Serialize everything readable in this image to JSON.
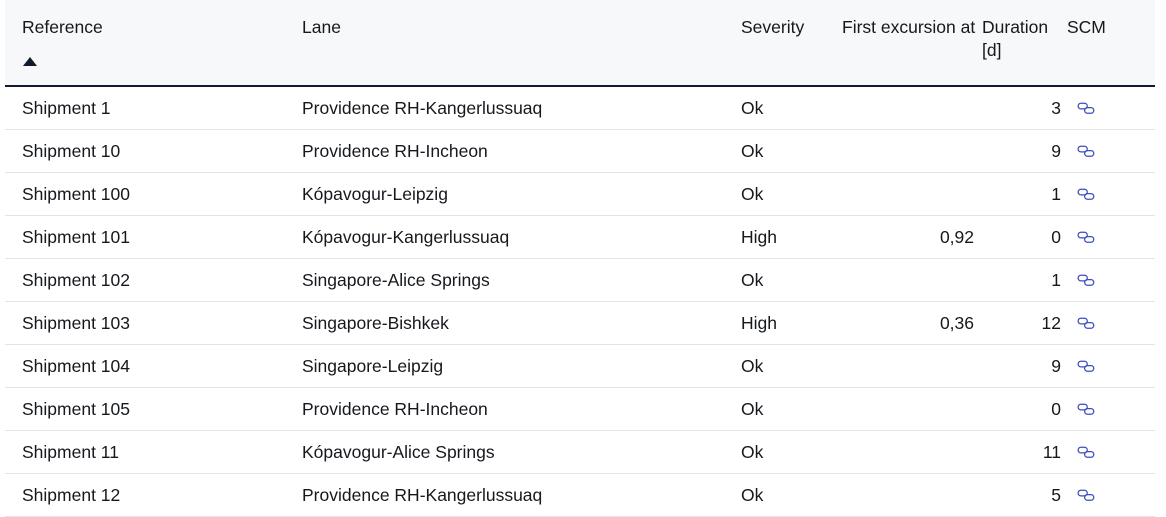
{
  "table": {
    "columns": [
      {
        "key": "reference",
        "label": "Reference",
        "align": "left",
        "sorted": "asc",
        "sort_icon": "sort-ascending-triangle-icon"
      },
      {
        "key": "lane",
        "label": "Lane",
        "align": "left"
      },
      {
        "key": "severity",
        "label": "Severity",
        "align": "left"
      },
      {
        "key": "first_excursion_at",
        "label": "First excursion at",
        "align": "right"
      },
      {
        "key": "duration",
        "label": "Duration [d]",
        "align": "right"
      },
      {
        "key": "scm",
        "label": "SCM",
        "align": "left"
      }
    ],
    "rows": [
      {
        "reference": "Shipment 1",
        "lane": "Providence RH-Kangerlussuaq",
        "severity": "Ok",
        "first_excursion_at": "",
        "duration": "3",
        "scm_icon": "chain-link-icon"
      },
      {
        "reference": "Shipment 10",
        "lane": "Providence RH-Incheon",
        "severity": "Ok",
        "first_excursion_at": "",
        "duration": "9",
        "scm_icon": "chain-link-icon"
      },
      {
        "reference": "Shipment 100",
        "lane": "Kópavogur-Leipzig",
        "severity": "Ok",
        "first_excursion_at": "",
        "duration": "1",
        "scm_icon": "chain-link-icon"
      },
      {
        "reference": "Shipment 101",
        "lane": "Kópavogur-Kangerlussuaq",
        "severity": "High",
        "first_excursion_at": "0,92",
        "duration": "0",
        "scm_icon": "chain-link-icon"
      },
      {
        "reference": "Shipment 102",
        "lane": "Singapore-Alice Springs",
        "severity": "Ok",
        "first_excursion_at": "",
        "duration": "1",
        "scm_icon": "chain-link-icon"
      },
      {
        "reference": "Shipment 103",
        "lane": "Singapore-Bishkek",
        "severity": "High",
        "first_excursion_at": "0,36",
        "duration": "12",
        "scm_icon": "chain-link-icon"
      },
      {
        "reference": "Shipment 104",
        "lane": "Singapore-Leipzig",
        "severity": "Ok",
        "first_excursion_at": "",
        "duration": "9",
        "scm_icon": "chain-link-icon"
      },
      {
        "reference": "Shipment 105",
        "lane": "Providence RH-Incheon",
        "severity": "Ok",
        "first_excursion_at": "",
        "duration": "0",
        "scm_icon": "chain-link-icon"
      },
      {
        "reference": "Shipment 11",
        "lane": "Kópavogur-Alice Springs",
        "severity": "Ok",
        "first_excursion_at": "",
        "duration": "11",
        "scm_icon": "chain-link-icon"
      },
      {
        "reference": "Shipment 12",
        "lane": "Providence RH-Kangerlussuaq",
        "severity": "Ok",
        "first_excursion_at": "",
        "duration": "5",
        "scm_icon": "chain-link-icon"
      }
    ]
  },
  "colors": {
    "header_background": "#f6f8fa",
    "header_rule": "#111a2e",
    "row_rule": "#e3e4e6",
    "text": "#15181d",
    "link_icon": "#3b4cc0",
    "page_background": "#ffffff"
  }
}
